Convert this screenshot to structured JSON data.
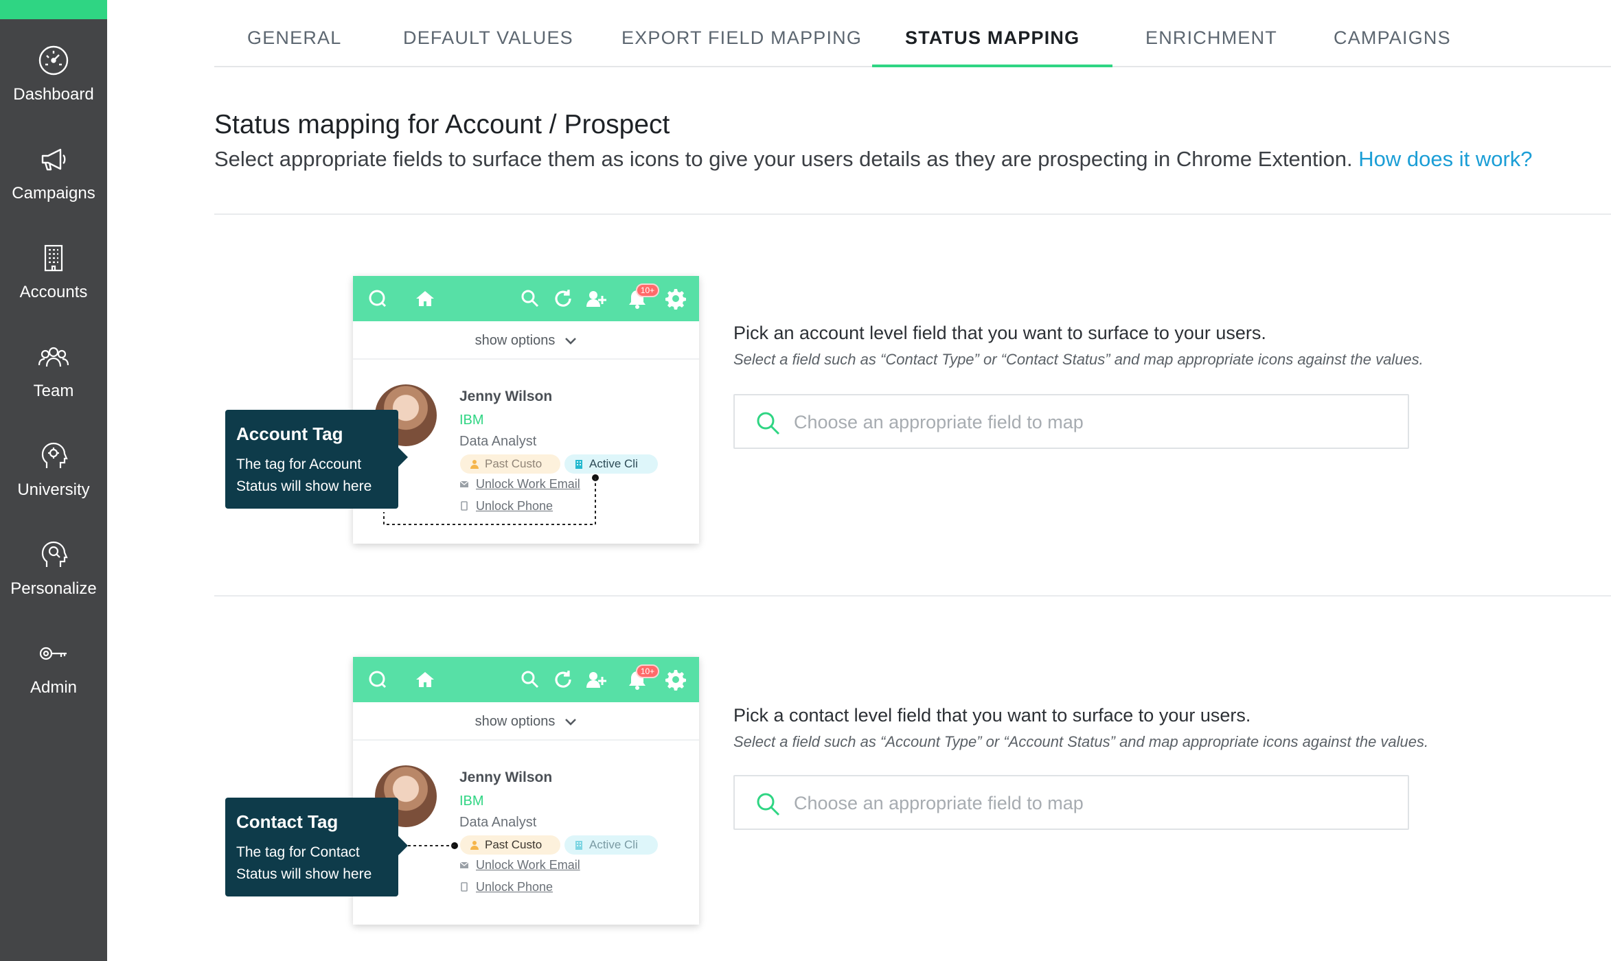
{
  "sidebar": {
    "items": [
      {
        "label": "Dashboard",
        "icon": "dashboard-gauge-icon"
      },
      {
        "label": "Campaigns",
        "icon": "megaphone-icon"
      },
      {
        "label": "Accounts",
        "icon": "building-icon"
      },
      {
        "label": "Team",
        "icon": "team-icon"
      },
      {
        "label": "University",
        "icon": "head-gear-icon"
      },
      {
        "label": "Personalize",
        "icon": "head-search-icon"
      },
      {
        "label": "Admin",
        "icon": "key-icon"
      }
    ]
  },
  "tabs": [
    {
      "label": "GENERAL"
    },
    {
      "label": "DEFAULT VALUES"
    },
    {
      "label": "EXPORT FIELD MAPPING"
    },
    {
      "label": "STATUS MAPPING",
      "active": true
    },
    {
      "label": "ENRICHMENT"
    },
    {
      "label": "CAMPAIGNS"
    }
  ],
  "header": {
    "title": "Status mapping for Account / Prospect",
    "subtitle": "Select appropriate fields to surface them as icons to give your users details as they are prospecting in Chrome Extention.",
    "help_link": "How does it work?"
  },
  "preview": {
    "show_options": "show options",
    "notification_badge": "10+",
    "name": "Jenny Wilson",
    "company": "IBM",
    "role": "Data Analyst",
    "tag_past": "Past Custo",
    "tag_active": "Active Cli",
    "unlock_email": "Unlock Work Email",
    "unlock_phone": "Unlock Phone"
  },
  "sections": [
    {
      "callout_title": "Account Tag",
      "callout_desc": "The tag for Account Status will show here",
      "pick_title": "Pick an account level field that you want to surface to your users.",
      "pick_subtitle": "Select a field such as “Contact Type” or “Contact Status” and map appropriate icons against the values.",
      "placeholder": "Choose an appropriate field to map"
    },
    {
      "callout_title": "Contact Tag",
      "callout_desc": "The tag for Contact Status will show here",
      "pick_title": "Pick a contact level field that you want to surface to your users.",
      "pick_subtitle": "Select a field such as “Account Type” or “Account Status” and map appropriate icons against the values.",
      "placeholder": "Choose an appropriate field to map"
    }
  ],
  "colors": {
    "accent": "#2fd583",
    "sidebar": "#444547",
    "extension_bar": "#57e0a6",
    "callout": "#0e3b4a",
    "link": "#1b9ed6"
  }
}
